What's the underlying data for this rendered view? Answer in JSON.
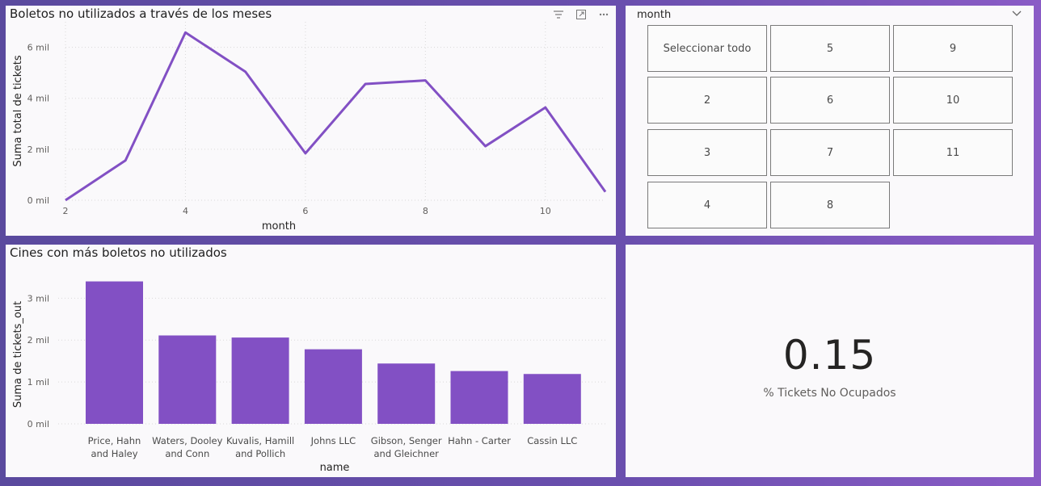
{
  "line_panel": {
    "title": "Boletos no utilizados a través de los meses",
    "icons": [
      "filter-icon",
      "focus-mode-icon",
      "more-options-icon"
    ]
  },
  "bar_panel": {
    "title": "Cines con más boletos no utilizados"
  },
  "slicer": {
    "title": "month",
    "tiles": [
      "Seleccionar todo",
      "5",
      "9",
      "2",
      "6",
      "10",
      "3",
      "7",
      "11",
      "4",
      "8"
    ]
  },
  "card": {
    "value": "0.15",
    "label": "% Tickets No Ocupados"
  },
  "colors": {
    "accent": "#8250c4",
    "grid": "#d9d9d9",
    "axis_text": "#605e5c"
  },
  "chart_data": [
    {
      "type": "line",
      "title": "Boletos no utilizados a través de los meses",
      "xlabel": "month",
      "ylabel": "Suma total de tickets",
      "x": [
        2,
        3,
        4,
        5,
        6,
        7,
        8,
        9,
        10,
        11
      ],
      "series": [
        {
          "values": [
            0,
            1560,
            6580,
            5040,
            1840,
            4560,
            4700,
            2120,
            3640,
            330
          ]
        }
      ],
      "xticks": [
        2,
        4,
        6,
        8,
        10
      ],
      "yticks": [
        0,
        2000,
        4000,
        6000
      ],
      "ytick_labels": [
        "0 mil",
        "2 mil",
        "4 mil",
        "6 mil"
      ],
      "xlim": [
        2,
        11
      ],
      "ylim": [
        0,
        7000
      ],
      "grid": true
    },
    {
      "type": "bar",
      "title": "Cines con más boletos no utilizados",
      "xlabel": "name",
      "ylabel": "Suma de tickets_out",
      "categories": [
        "Price, Hahn and Haley",
        "Waters, Dooley and Conn",
        "Kuvalis, Hamill and Pollich",
        "Johns LLC",
        "Gibson, Senger and Gleichner",
        "Hahn - Carter",
        "Cassin LLC"
      ],
      "category_lines": [
        [
          "Price, Hahn",
          "and Haley"
        ],
        [
          "Waters, Dooley",
          "and Conn"
        ],
        [
          "Kuvalis, Hamill",
          "and Pollich"
        ],
        [
          "Johns LLC"
        ],
        [
          "Gibson, Senger",
          "and Gleichner"
        ],
        [
          "Hahn - Carter"
        ],
        [
          "Cassin LLC"
        ]
      ],
      "values": [
        3400,
        2110,
        2060,
        1780,
        1440,
        1260,
        1190
      ],
      "yticks": [
        0,
        1000,
        2000,
        3000
      ],
      "ytick_labels": [
        "0 mil",
        "1 mil",
        "2 mil",
        "3 mil"
      ],
      "ylim": [
        0,
        3700
      ],
      "grid": true
    }
  ]
}
